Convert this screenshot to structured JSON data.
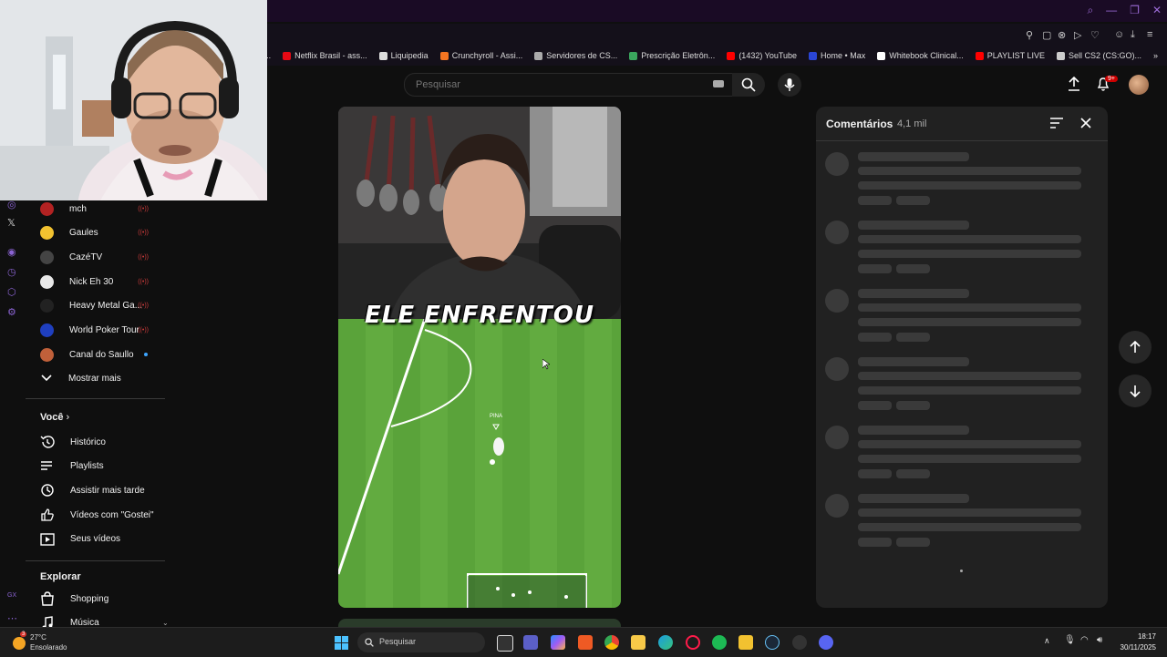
{
  "browser": {
    "bookmarks": [
      {
        "label": "o Reis...",
        "icon": "generic-bookmark-icon",
        "color": "#444444"
      },
      {
        "label": "Netflix Brasil - ass...",
        "icon": "netflix-icon",
        "color": "#e50914"
      },
      {
        "label": "Liquipedia",
        "icon": "liquipedia-icon",
        "color": "#dddddd"
      },
      {
        "label": "Crunchyroll - Assi...",
        "icon": "crunchyroll-icon",
        "color": "#f47521"
      },
      {
        "label": "Servidores de CS...",
        "icon": "cs-icon",
        "color": "#aaaaaa"
      },
      {
        "label": "Prescrição Eletrôn...",
        "icon": "prescription-icon",
        "color": "#3aa55d"
      },
      {
        "label": "(1432) YouTube",
        "icon": "youtube-icon",
        "color": "#ff0000"
      },
      {
        "label": "Home • Max",
        "icon": "max-icon",
        "color": "#2a45d6"
      },
      {
        "label": "Whitebook Clinical...",
        "icon": "whitebook-icon",
        "color": "#ffffff"
      },
      {
        "label": "PLAYLIST LIVE",
        "icon": "youtube-icon",
        "color": "#ff0000"
      },
      {
        "label": "Sell CS2 (CS:GO)...",
        "icon": "sell-icon",
        "color": "#cccccc"
      }
    ]
  },
  "header": {
    "search_placeholder": "Pesquisar",
    "notification_count": "9+"
  },
  "sidebar": {
    "channels": [
      {
        "label": "mch",
        "color": "#b22222",
        "live": true
      },
      {
        "label": "Gaules",
        "color": "#f2c230",
        "live": true
      },
      {
        "label": "CazéTV",
        "color": "#444444",
        "live": true
      },
      {
        "label": "Nick Eh 30",
        "color": "#e8e8e8",
        "live": true
      },
      {
        "label": "Heavy Metal Ga...",
        "color": "#222222",
        "live": true
      },
      {
        "label": "World Poker Tour",
        "color": "#1f3fbf",
        "live": true
      },
      {
        "label": "Canal do Saullo",
        "color": "#c0603a",
        "live": false,
        "new": true
      }
    ],
    "show_more": "Mostrar mais",
    "you_heading": "Você",
    "you_items": [
      {
        "label": "Histórico",
        "icon": "history-icon"
      },
      {
        "label": "Playlists",
        "icon": "playlists-icon"
      },
      {
        "label": "Assistir mais tarde",
        "icon": "watch-later-icon"
      },
      {
        "label": "Vídeos com \"Gostei\"",
        "icon": "like-icon"
      },
      {
        "label": "Seus vídeos",
        "icon": "your-videos-icon"
      }
    ],
    "explore_heading": "Explorar",
    "explore_items": [
      {
        "label": "Shopping",
        "icon": "shopping-icon"
      },
      {
        "label": "Música",
        "icon": "music-icon"
      }
    ]
  },
  "video": {
    "caption": "ELE ENFRENTOU",
    "player_tag": "PINA"
  },
  "comments": {
    "title": "Comentários",
    "count": "4,1 mil"
  },
  "taskbar": {
    "temperature": "27°C",
    "condition": "Ensolarado",
    "weather_badge": "3",
    "search_placeholder": "Pesquisar",
    "time": "18:17",
    "date": "30/11/2025"
  }
}
